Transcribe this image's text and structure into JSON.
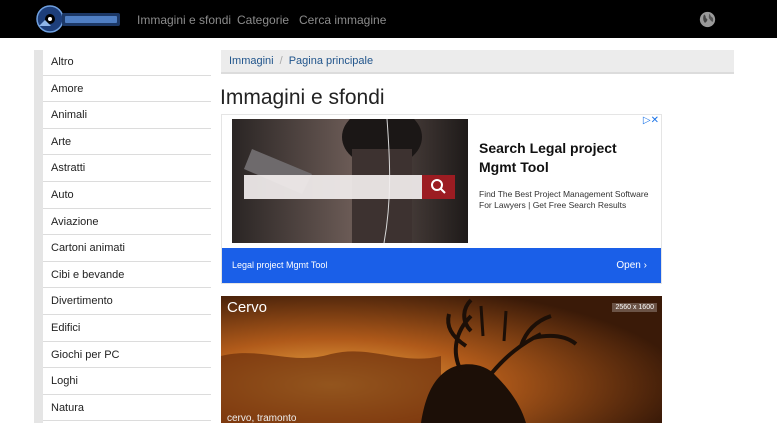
{
  "header": {
    "nav": [
      "Immagini e sfondi",
      "Categorie",
      "Cerca immagine"
    ]
  },
  "sidebar": {
    "items": [
      "Altro",
      "Amore",
      "Animali",
      "Arte",
      "Astratti",
      "Auto",
      "Aviazione",
      "Cartoni animati",
      "Cibi e bevande",
      "Divertimento",
      "Edifici",
      "Giochi per PC",
      "Loghi",
      "Natura"
    ]
  },
  "breadcrumb": {
    "items": [
      "Immagini",
      "Pagina principale"
    ],
    "separator": "/"
  },
  "page_title": "Immagini e sfondi",
  "ad": {
    "title": "Search Legal project Mgmt Tool",
    "description": "Find The Best Project Management Software For Lawyers | Get Free Search Results",
    "cta_text": "Legal project Mgmt Tool",
    "open_label": "Open",
    "close_glyph": "▷✕",
    "accent_color": "#1a5fe8"
  },
  "featured": {
    "title": "Cervo",
    "resolution": "2560 x 1600",
    "tags": "cervo, tramonto"
  }
}
